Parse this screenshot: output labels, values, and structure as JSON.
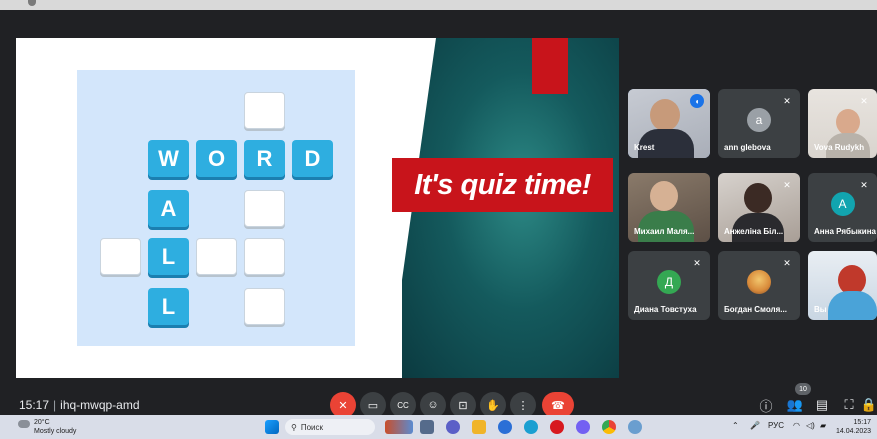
{
  "slide": {
    "banner_text": "It's quiz time!",
    "tiles": [
      "W",
      "O",
      "R",
      "D",
      "A",
      "L",
      "L"
    ]
  },
  "participants": [
    {
      "name": "Krest",
      "type": "video",
      "speaking": true
    },
    {
      "name": "ann glebova",
      "type": "avatar",
      "initial": "a",
      "color": "#9aa0a6",
      "muted": true
    },
    {
      "name": "Vova Rudykh",
      "type": "video",
      "muted": true
    },
    {
      "name": "Михаил Маля...",
      "type": "video"
    },
    {
      "name": "Анжеліна Біл...",
      "type": "video",
      "muted": true
    },
    {
      "name": "Анна Рябыкина",
      "type": "avatar",
      "initial": "А",
      "color": "#12a4af",
      "muted": true
    },
    {
      "name": "Диана Товстуха",
      "type": "avatar",
      "initial": "Д",
      "color": "#34a853",
      "muted": true
    },
    {
      "name": "Богдан Смоля...",
      "type": "photo",
      "muted": true
    },
    {
      "name": "Вы",
      "type": "video"
    }
  ],
  "meeting": {
    "time": "15:17",
    "code": "ihq-mwqp-amd",
    "participant_count": "10"
  },
  "controls": [
    {
      "name": "mic-off-icon",
      "glyph": "✕"
    },
    {
      "name": "camera-icon",
      "glyph": "▭"
    },
    {
      "name": "captions-icon",
      "glyph": "CC"
    },
    {
      "name": "emoji-icon",
      "glyph": "☺"
    },
    {
      "name": "present-icon",
      "glyph": "⊡"
    },
    {
      "name": "raise-hand-icon",
      "glyph": "✋"
    },
    {
      "name": "more-options-icon",
      "glyph": "⋮"
    },
    {
      "name": "hang-up-icon",
      "glyph": "☎"
    }
  ],
  "taskbar": {
    "temperature": "20°C",
    "weather": "Mostly cloudy",
    "search_placeholder": "Поиск",
    "language": "РУС",
    "clock_time": "15:17",
    "clock_date": "14.04.2023"
  },
  "colors": {
    "meet_bg": "#202124",
    "tile_blue": "#2eaee0",
    "banner_red": "#c8141b",
    "hangup_red": "#ea4335"
  }
}
